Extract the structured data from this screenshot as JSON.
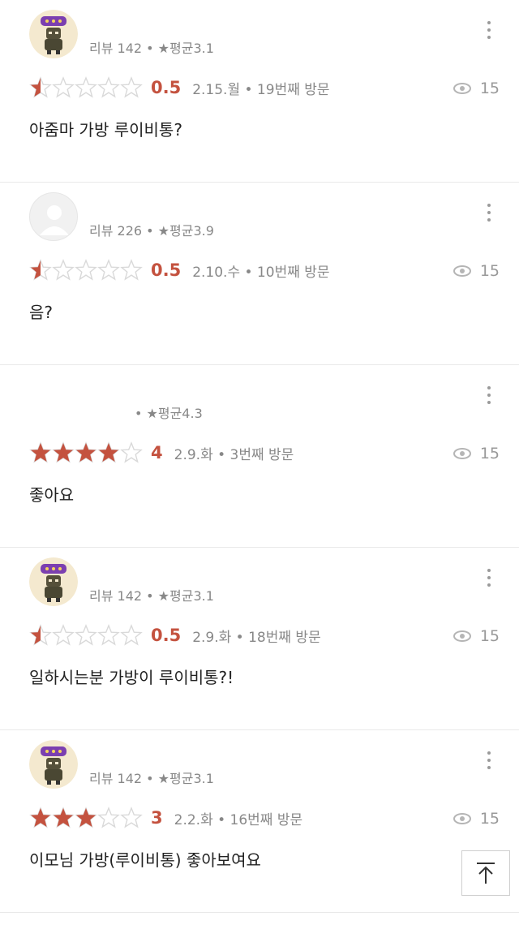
{
  "reviews": [
    {
      "avatar": "mascot",
      "meta": "리뷰 142 • ★평균3.1",
      "rating": 0.5,
      "score": "0.5",
      "visit": "2.15.월 • 19번째 방문",
      "views": "15",
      "comment": "아줌마 가방 루이비통?"
    },
    {
      "avatar": "blank",
      "meta": "리뷰 226 • ★평균3.9",
      "rating": 0.5,
      "score": "0.5",
      "visit": "2.10.수 • 10번째 방문",
      "views": "15",
      "comment": "음?"
    },
    {
      "avatar": "none",
      "meta": "• ★평균4.3",
      "rating": 4,
      "score": "4",
      "visit": "2.9.화 • 3번째 방문",
      "views": "15",
      "comment": "좋아요"
    },
    {
      "avatar": "mascot",
      "meta": "리뷰 142 • ★평균3.1",
      "rating": 0.5,
      "score": "0.5",
      "visit": "2.9.화 • 18번째 방문",
      "views": "15",
      "comment": "일하시는분 가방이 루이비통?!"
    },
    {
      "avatar": "mascot",
      "meta": "리뷰 142 • ★평균3.1",
      "rating": 3,
      "score": "3",
      "visit": "2.2.화 • 16번째 방문",
      "views": "15",
      "comment": "이모님 가방(루이비통) 좋아보여요"
    }
  ],
  "colors": {
    "star_filled": "#c4523f",
    "star_empty": "#d9d9d9",
    "score": "#c4523f"
  },
  "icons": {
    "more": "more-vertical-icon",
    "views": "eye-icon",
    "scroll_top": "arrow-up-to-top-icon"
  }
}
